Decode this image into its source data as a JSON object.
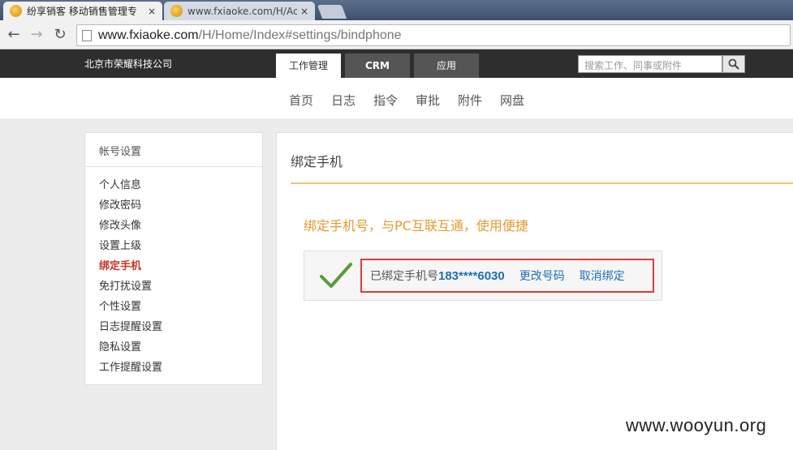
{
  "browser": {
    "tabs": [
      {
        "title": "纷享销客 移动销售管理专",
        "active": true
      },
      {
        "title": "www.fxiaoke.com/H/Acc",
        "active": false
      }
    ],
    "close_glyph": "×",
    "url_host": "www.fxiaoke.com",
    "url_path": "/H/Home/Index#settings/bindphone",
    "nav": {
      "back": "←",
      "forward": "→",
      "reload": "↻"
    }
  },
  "header": {
    "company": "北京市荣耀科技公司",
    "tabs": [
      "工作管理",
      "CRM",
      "应用"
    ],
    "search_placeholder": "搜索工作、同事或附件"
  },
  "subnav": [
    "首页",
    "日志",
    "指令",
    "审批",
    "附件",
    "网盘"
  ],
  "sidebar": {
    "title": "帐号设置",
    "items": [
      "个人信息",
      "修改密码",
      "修改头像",
      "设置上级",
      "绑定手机",
      "免打扰设置",
      "个性设置",
      "日志提醒设置",
      "隐私设置",
      "工作提醒设置"
    ],
    "active_index": 4
  },
  "main": {
    "title": "绑定手机",
    "slogan": "绑定手机号，与PC互联互通，使用便捷",
    "bound_label": "已绑定手机号",
    "phone": "183****6030",
    "change_link": "更改号码",
    "unbind_link": "取消绑定"
  },
  "watermark": "www.wooyun.org",
  "colors": {
    "accent": "#e59a2e",
    "link": "#1f6fb5",
    "active": "#c0392b",
    "highlight": "#e53935",
    "check": "#5a9a3c"
  }
}
